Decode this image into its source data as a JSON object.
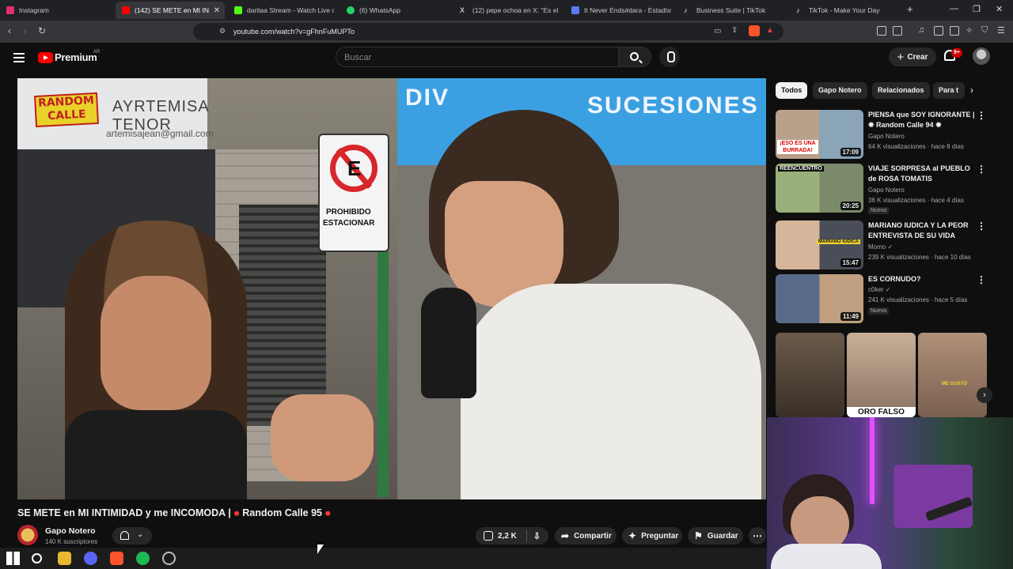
{
  "browser": {
    "tabs": [
      {
        "title": "Instagram",
        "favicon_color": "#e1306c"
      },
      {
        "title": "(142) SE METE en MI IN",
        "favicon_color": "#ff0000",
        "active": true
      },
      {
        "title": "daritaa Stream - Watch Live on",
        "favicon_color": "#53fc18"
      },
      {
        "title": "(6) WhatsApp",
        "favicon_color": "#25d366"
      },
      {
        "title": "(12) pepe ochoa en X: \"Es el m",
        "favicon_color": "#ffffff"
      },
      {
        "title": "It Never Ends#dara - Estadístic",
        "favicon_color": "#5b7cfa"
      },
      {
        "title": "Business Suite | TikTok",
        "favicon_color": "#ffffff"
      },
      {
        "title": "TikTok - Make Your Day",
        "favicon_color": "#ffffff"
      }
    ],
    "new_tab": "+",
    "url": "youtube.com/watch?v=gFhnFuMUPTo"
  },
  "youtube": {
    "brand": "Premium",
    "region": "AR",
    "search_placeholder": "Buscar",
    "create_label": "Crear",
    "notifications": "9+"
  },
  "video": {
    "title": "SE METE en MI INTIMIDAD y me INCOMODA |",
    "title_suffix": "Random Calle 95",
    "overlay_logo": "RANDOM CALLE",
    "scene_sign_shop": "AYRTEMISA TENOR",
    "scene_email": "artemisajean@gmail.com",
    "scene_banner_1": "DIV",
    "scene_banner_2": "SUCESIONES",
    "scene_sign_line1": "PROHIBIDO",
    "scene_sign_line2": "ESTACIONAR",
    "channel_name": "Gapo Notero",
    "subscribers": "140 K suscriptores",
    "likes": "2,2 K",
    "share_label": "Compartir",
    "ask_label": "Preguntar",
    "save_label": "Guardar"
  },
  "chips": [
    "Todos",
    "Gapo Notero",
    "Relacionados",
    "Para t"
  ],
  "recommendations": [
    {
      "title": "PIENSA que SOY IGNORANTE | ✹ Random Calle 94 ✹",
      "channel": "Gapo Notero",
      "meta": "64 K visualizaciones · hace 8 días",
      "duration": "17:09",
      "thumb_text": "¡ESO ES UNA BURRADA!",
      "badge": ""
    },
    {
      "title": "VIAJE SORPRESA al PUEBLO de ROSA TOMATIS",
      "channel": "Gapo Notero",
      "meta": "36 K visualizaciones · hace 4 días",
      "duration": "20:25",
      "thumb_text": "REENCUENTRO",
      "badge": "Nuevo"
    },
    {
      "title": "MARIANO IUDICA Y LA PEOR ENTREVISTA DE SU VIDA",
      "channel": "Momo ✓",
      "meta": "239 K visualizaciones · hace 10 días",
      "duration": "15:47",
      "thumb_text": "MARIANO IUDICA",
      "badge": ""
    },
    {
      "title": "ES CORNUDO?",
      "channel": "c0ker ✓",
      "meta": "241 K visualizaciones · hace 5 días",
      "duration": "11:49",
      "thumb_text": "",
      "badge": "Nuevo"
    }
  ],
  "shorts": [
    {
      "caption": ""
    },
    {
      "caption": "ORO FALSO"
    },
    {
      "caption": "ME GUSTÓ"
    }
  ],
  "colors": {
    "accent": "#ff0000",
    "background": "#0f0f0f",
    "chip_bg": "#272727"
  }
}
